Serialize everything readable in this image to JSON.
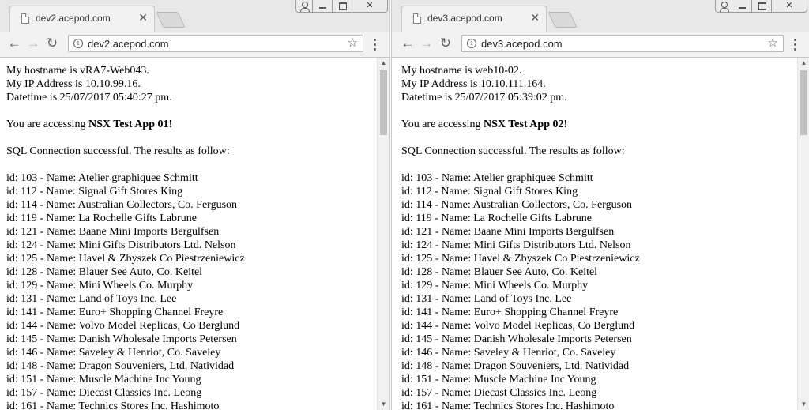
{
  "windows": [
    {
      "tab_title": "dev2.acepod.com",
      "url": "dev2.acepod.com",
      "hostname_line": "My hostname is vRA7-Web043.",
      "ip_line": "My IP Address is 10.10.99.16.",
      "datetime_line": "Datetime is 25/07/2017 05:40:27 pm.",
      "access_prefix": "You are accessing ",
      "app_name": "NSX Test App 01!",
      "sql_line": "SQL Connection successful. The results as follow:"
    },
    {
      "tab_title": "dev3.acepod.com",
      "url": "dev3.acepod.com",
      "hostname_line": "My hostname is web10-02.",
      "ip_line": "My IP Address is 10.10.111.164.",
      "datetime_line": "Datetime is 25/07/2017 05:39:02 pm.",
      "access_prefix": "You are accessing ",
      "app_name": "NSX Test App 02!",
      "sql_line": "SQL Connection successful. The results as follow:"
    }
  ],
  "results": [
    "id: 103 - Name: Atelier graphiquee Schmitt",
    "id: 112 - Name: Signal Gift Stores King",
    "id: 114 - Name: Australian Collectors, Co. Ferguson",
    "id: 119 - Name: La Rochelle Gifts Labrune",
    "id: 121 - Name: Baane Mini Imports Bergulfsen",
    "id: 124 - Name: Mini Gifts Distributors Ltd. Nelson",
    "id: 125 - Name: Havel & Zbyszek Co Piestrzeniewicz",
    "id: 128 - Name: Blauer See Auto, Co. Keitel",
    "id: 129 - Name: Mini Wheels Co. Murphy",
    "id: 131 - Name: Land of Toys Inc. Lee",
    "id: 141 - Name: Euro+ Shopping Channel Freyre",
    "id: 144 - Name: Volvo Model Replicas, Co Berglund",
    "id: 145 - Name: Danish Wholesale Imports Petersen",
    "id: 146 - Name: Saveley & Henriot, Co. Saveley",
    "id: 148 - Name: Dragon Souveniers, Ltd. Natividad",
    "id: 151 - Name: Muscle Machine Inc Young",
    "id: 157 - Name: Diecast Classics Inc. Leong",
    "id: 161 - Name: Technics Stores Inc. Hashimoto"
  ],
  "icons": {
    "tab_close": "close-icon",
    "back": "arrow-left-icon",
    "forward": "arrow-right-icon",
    "reload": "reload-icon",
    "site_info": "info-icon",
    "bookmark": "star-icon",
    "menu": "kebab-menu-icon"
  }
}
